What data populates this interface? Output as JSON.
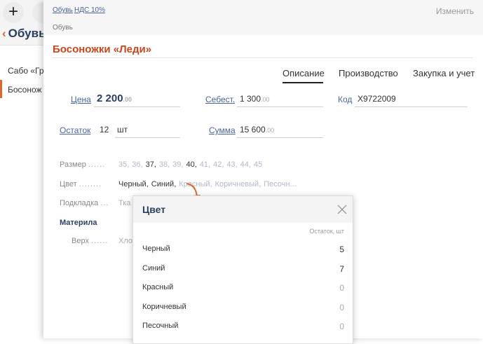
{
  "app": {
    "back_label": "Обувь",
    "list_items": [
      "Сабо «Гр",
      "Босонож"
    ],
    "add_label": "+"
  },
  "card": {
    "breadcrumb": {
      "category": "Обувь",
      "tax": "НДС 10%"
    },
    "subtitle": "Обувь",
    "edit_label": "Изменить",
    "title": "Босоножки «Леди»",
    "tabs": [
      "Описание",
      "Производство",
      "Закупка и учет"
    ],
    "active_tab": "Описание",
    "fields": {
      "price": {
        "label": "Цена",
        "value": "2 200",
        "decimals": ".00"
      },
      "cost": {
        "label": "Себест.",
        "value": "1 300",
        "decimals": ".00"
      },
      "code": {
        "label": "Код",
        "value": "X9722009"
      },
      "stock": {
        "label": "Остаток",
        "value": "12",
        "unit": "шт"
      },
      "sum": {
        "label": "Сумма",
        "value": "15 600",
        "decimals": ".00"
      }
    },
    "size": {
      "label": "Размер",
      "dots": "......",
      "values": [
        "35,",
        "36,",
        "37,",
        "38,",
        "39,",
        "40,",
        "41,",
        "42,",
        "43,",
        "44,",
        "45"
      ],
      "selected": [
        "37,",
        "40,"
      ]
    },
    "color": {
      "label": "Цвет",
      "dots": "........",
      "values": [
        "Черный,",
        "Синий,",
        "Красный,",
        "Коричневый,",
        "Песочн..."
      ],
      "selected": [
        "Черный,",
        "Синий,"
      ]
    },
    "lining": {
      "label": "Подкладка",
      "dots": "...",
      "value": "Тка"
    },
    "material": {
      "heading": "Материла",
      "upper": {
        "label": "Верх",
        "dots": "......",
        "value": "Хло"
      }
    }
  },
  "popup": {
    "title": "Цвет",
    "column_header": "Остаток, шт",
    "rows": [
      {
        "name": "Черный",
        "qty": "5"
      },
      {
        "name": "Синий",
        "qty": "7"
      },
      {
        "name": "Красный",
        "qty": "0"
      },
      {
        "name": "Коричневый",
        "qty": "0"
      },
      {
        "name": "Песочный",
        "qty": "0"
      }
    ]
  },
  "colors": {
    "accent": "#e0662a",
    "title": "#c9461c",
    "link": "#4a63a3",
    "heading": "#2b3f63"
  },
  "icons": [
    "plus-icon",
    "chevron-left-icon",
    "close-icon",
    "arrow-icon"
  ]
}
